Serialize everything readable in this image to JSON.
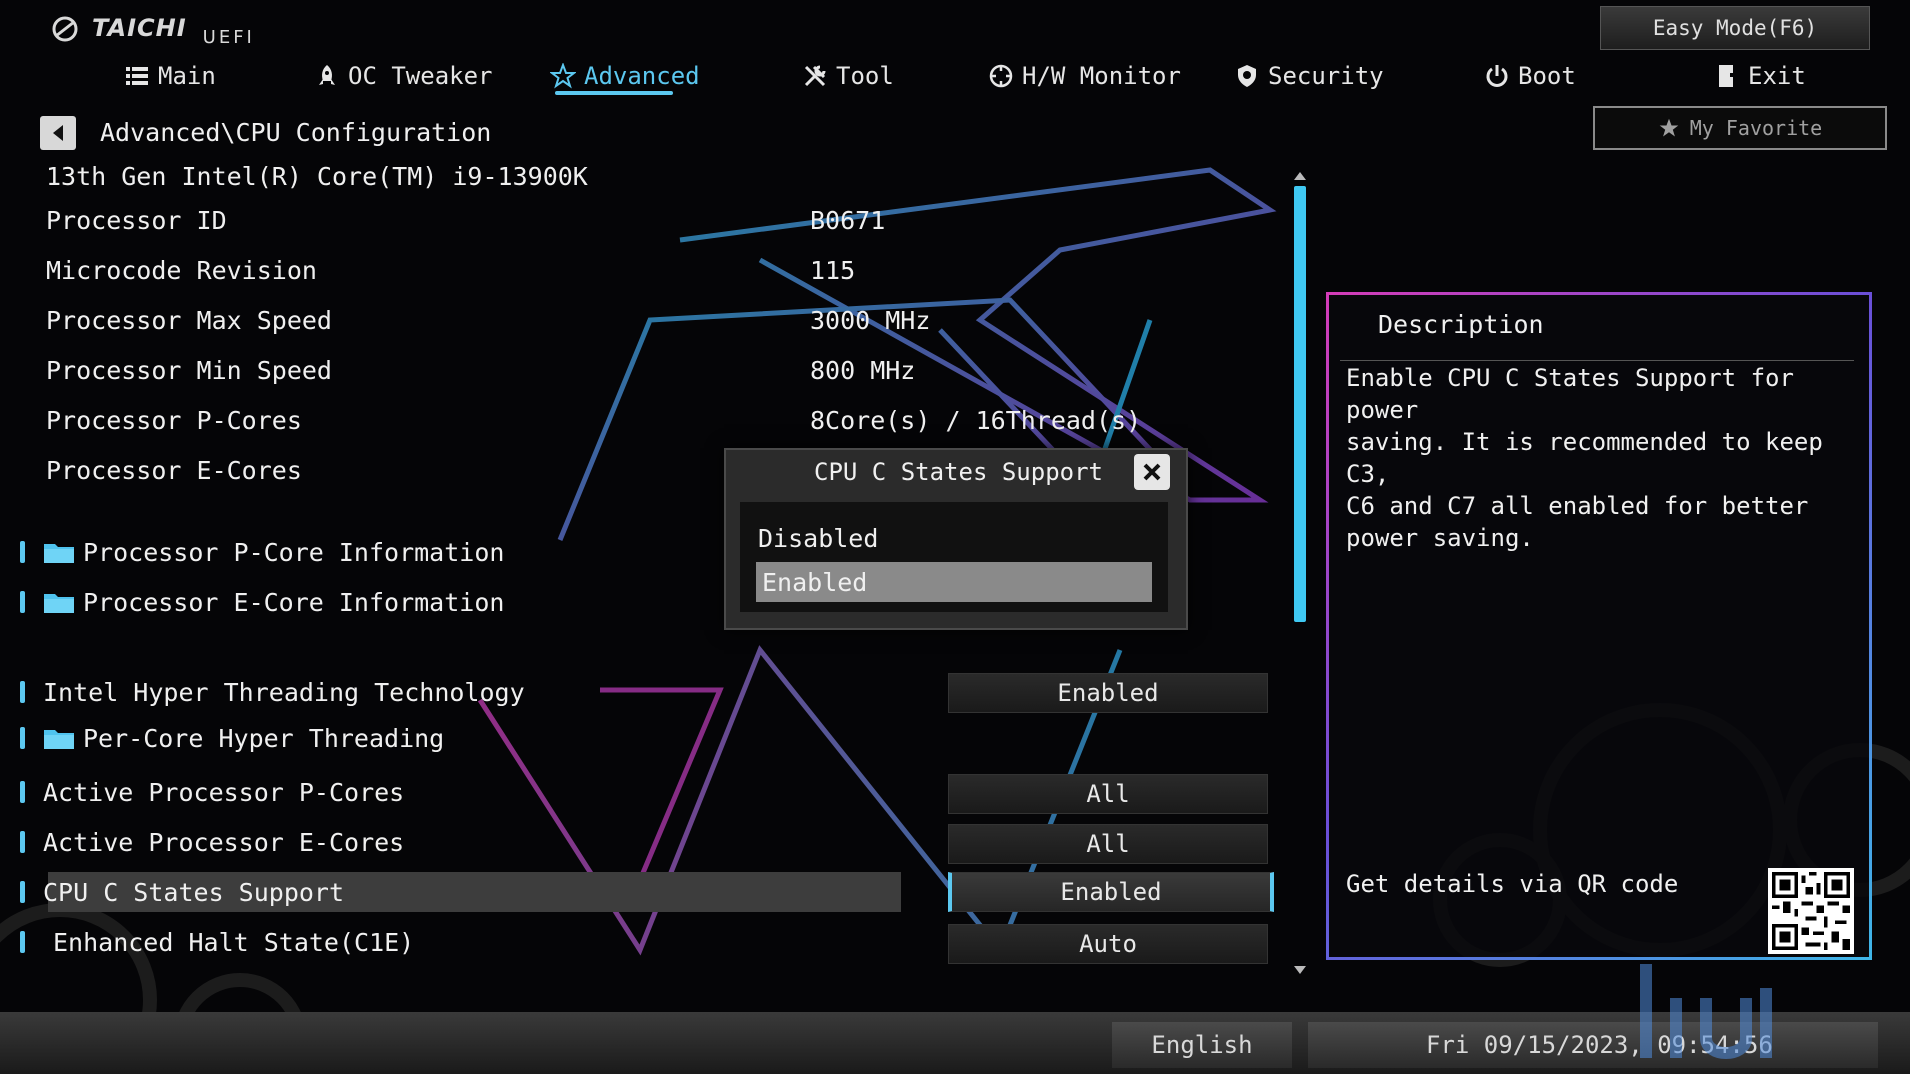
{
  "logo": {
    "brand": "TAICHI",
    "sub": "UEFI"
  },
  "nav": {
    "main": "Main",
    "oc_tweaker": "OC Tweaker",
    "advanced": "Advanced",
    "tool": "Tool",
    "hw_monitor": "H/W Monitor",
    "security": "Security",
    "boot": "Boot",
    "exit": "Exit",
    "active": "Advanced"
  },
  "buttons": {
    "easy_mode": "Easy Mode(F6)",
    "my_favorite": "My Favorite"
  },
  "breadcrumb": "Advanced\\CPU Configuration",
  "cpu_name": "13th Gen Intel(R) Core(TM) i9-13900K",
  "info": [
    {
      "label": "Processor ID",
      "value": "B0671"
    },
    {
      "label": "Microcode Revision",
      "value": "115"
    },
    {
      "label": "Processor Max Speed",
      "value": "3000 MHz"
    },
    {
      "label": "Processor Min Speed",
      "value": "800 MHz"
    },
    {
      "label": "Processor P-Cores",
      "value": "8Core(s) / 16Thread(s)"
    },
    {
      "label": "Processor E-Cores",
      "value": ""
    }
  ],
  "submenus": [
    {
      "label": "Processor P-Core Information"
    },
    {
      "label": "Processor E-Core Information"
    }
  ],
  "settings": [
    {
      "label": "Intel Hyper Threading Technology",
      "value": "Enabled"
    },
    {
      "label": "Per-Core Hyper Threading",
      "value": ""
    },
    {
      "label": "Active Processor P-Cores",
      "value": "All"
    },
    {
      "label": "Active Processor E-Cores",
      "value": "All"
    },
    {
      "label": "CPU C States Support",
      "value": "Enabled"
    },
    {
      "label": "Enhanced Halt State(C1E)",
      "value": "Auto"
    }
  ],
  "popup": {
    "title": "CPU C States Support",
    "options": [
      "Disabled",
      "Enabled"
    ],
    "selected": "Enabled"
  },
  "description": {
    "title": "Description",
    "text": "Enable CPU C States Support for power\nsaving. It is recommended to keep C3,\nC6 and C7 all enabled for better\npower saving.",
    "qr_label": "Get details via QR code"
  },
  "footer": {
    "language": "English",
    "datetime": "Fri 09/15/2023, 09:54:56"
  },
  "colors": {
    "accent": "#5cc8f0",
    "panel_border_start": "#d43cb8",
    "panel_border_end": "#3fb6e8"
  }
}
